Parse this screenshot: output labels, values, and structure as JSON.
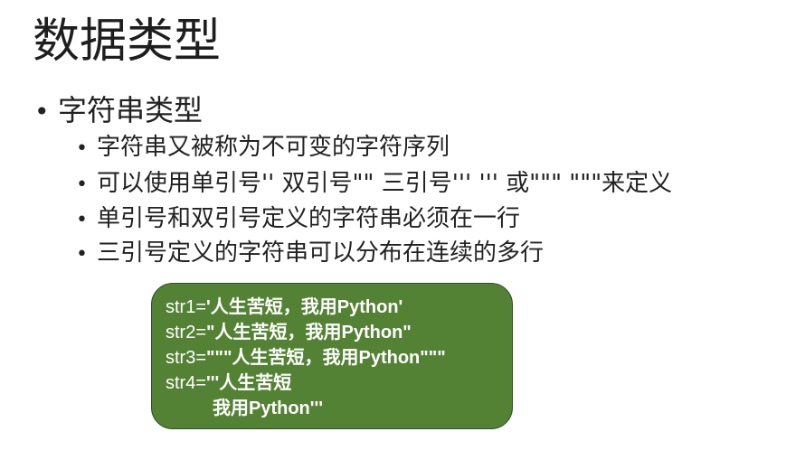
{
  "slide": {
    "title": "数据类型",
    "section": {
      "heading": "字符串类型",
      "points": [
        "字符串又被称为不可变的字符序列",
        "可以使用单引号'' 双引号\"\" 三引号''' ''' 或\"\"\" \"\"\"来定义",
        "单引号和双引号定义的字符串必须在一行",
        "三引号定义的字符串可以分布在连续的多行"
      ]
    },
    "code": {
      "lines": [
        {
          "var": "str1=",
          "val": "'人生苦短，我用Python'"
        },
        {
          "var": "str2=",
          "val": "\"人生苦短，我用Python\""
        },
        {
          "var": "str3=",
          "val": "\"\"\"人生苦短，我用Python\"\"\""
        },
        {
          "var": "str4=",
          "val": "'''人生苦短"
        },
        {
          "var": "",
          "val": "我用Python'''"
        }
      ]
    }
  },
  "colors": {
    "code_background": "#548235",
    "code_text": "#ffffff"
  }
}
